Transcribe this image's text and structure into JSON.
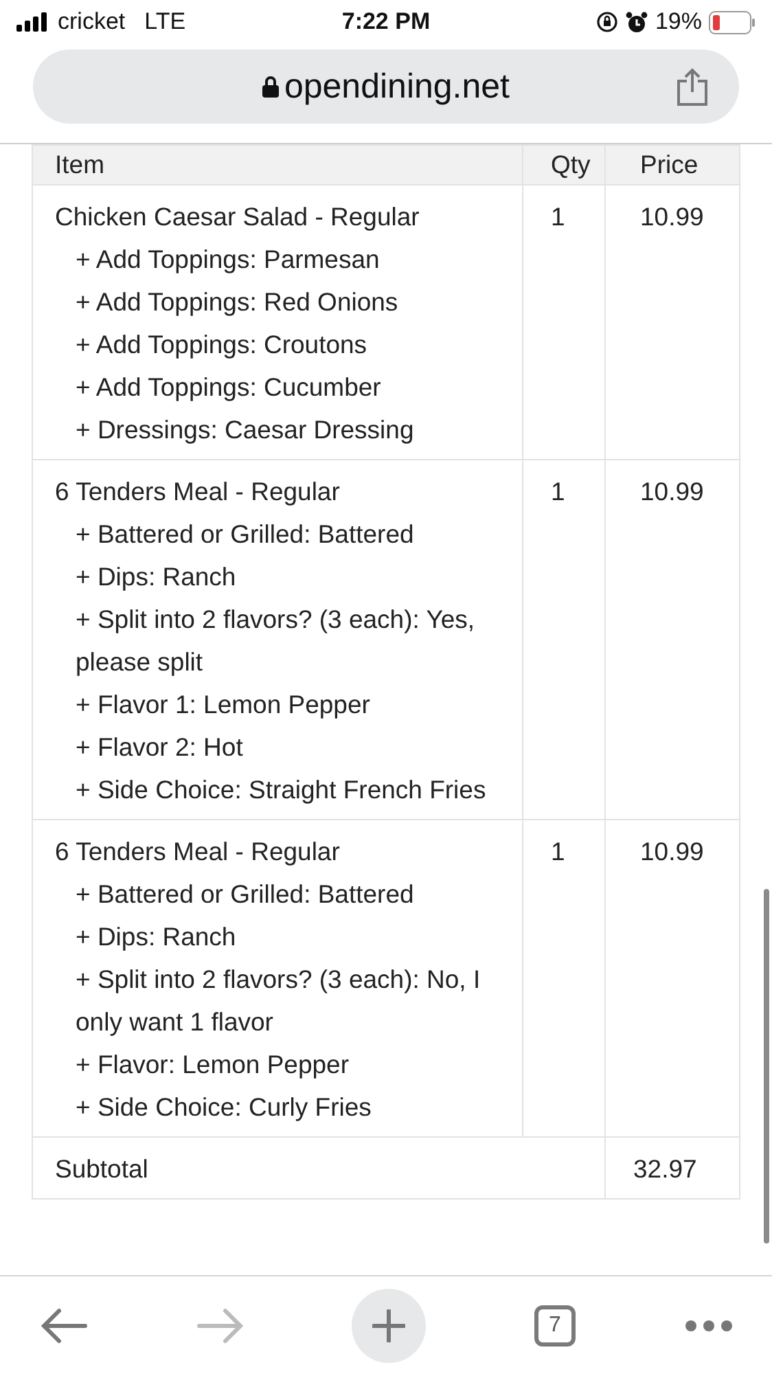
{
  "status_bar": {
    "carrier": "cricket",
    "network": "LTE",
    "time": "7:22 PM",
    "battery": "19%"
  },
  "address_bar": {
    "url": "opendining.net"
  },
  "table": {
    "columns": [
      "Item",
      "Qty",
      "Price"
    ],
    "rows": [
      {
        "item": "Chicken Caesar Salad - Regular",
        "options": [
          "+ Add Toppings: Parmesan",
          "+ Add Toppings: Red Onions",
          "+ Add Toppings: Croutons",
          "+ Add Toppings: Cucumber",
          "+ Dressings: Caesar Dressing"
        ],
        "qty": "1",
        "price": "10.99"
      },
      {
        "item": "6 Tenders Meal - Regular",
        "options": [
          "+ Battered or Grilled: Battered",
          "+ Dips: Ranch",
          "+ Split into 2 flavors? (3 each): Yes, please split",
          "+ Flavor 1: Lemon Pepper",
          "+ Flavor 2: Hot",
          "+ Side Choice: Straight French Fries"
        ],
        "qty": "1",
        "price": "10.99"
      },
      {
        "item": "6 Tenders Meal - Regular",
        "options": [
          "+ Battered or Grilled: Battered",
          "+ Dips: Ranch",
          "+ Split into 2 flavors? (3 each): No, I only want 1 flavor",
          "+ Flavor: Lemon Pepper",
          "+ Side Choice: Curly Fries"
        ],
        "qty": "1",
        "price": "10.99"
      }
    ],
    "subtotal": {
      "label": "Subtotal",
      "value": "32.97"
    }
  },
  "toolbar": {
    "tab_count": "7"
  }
}
